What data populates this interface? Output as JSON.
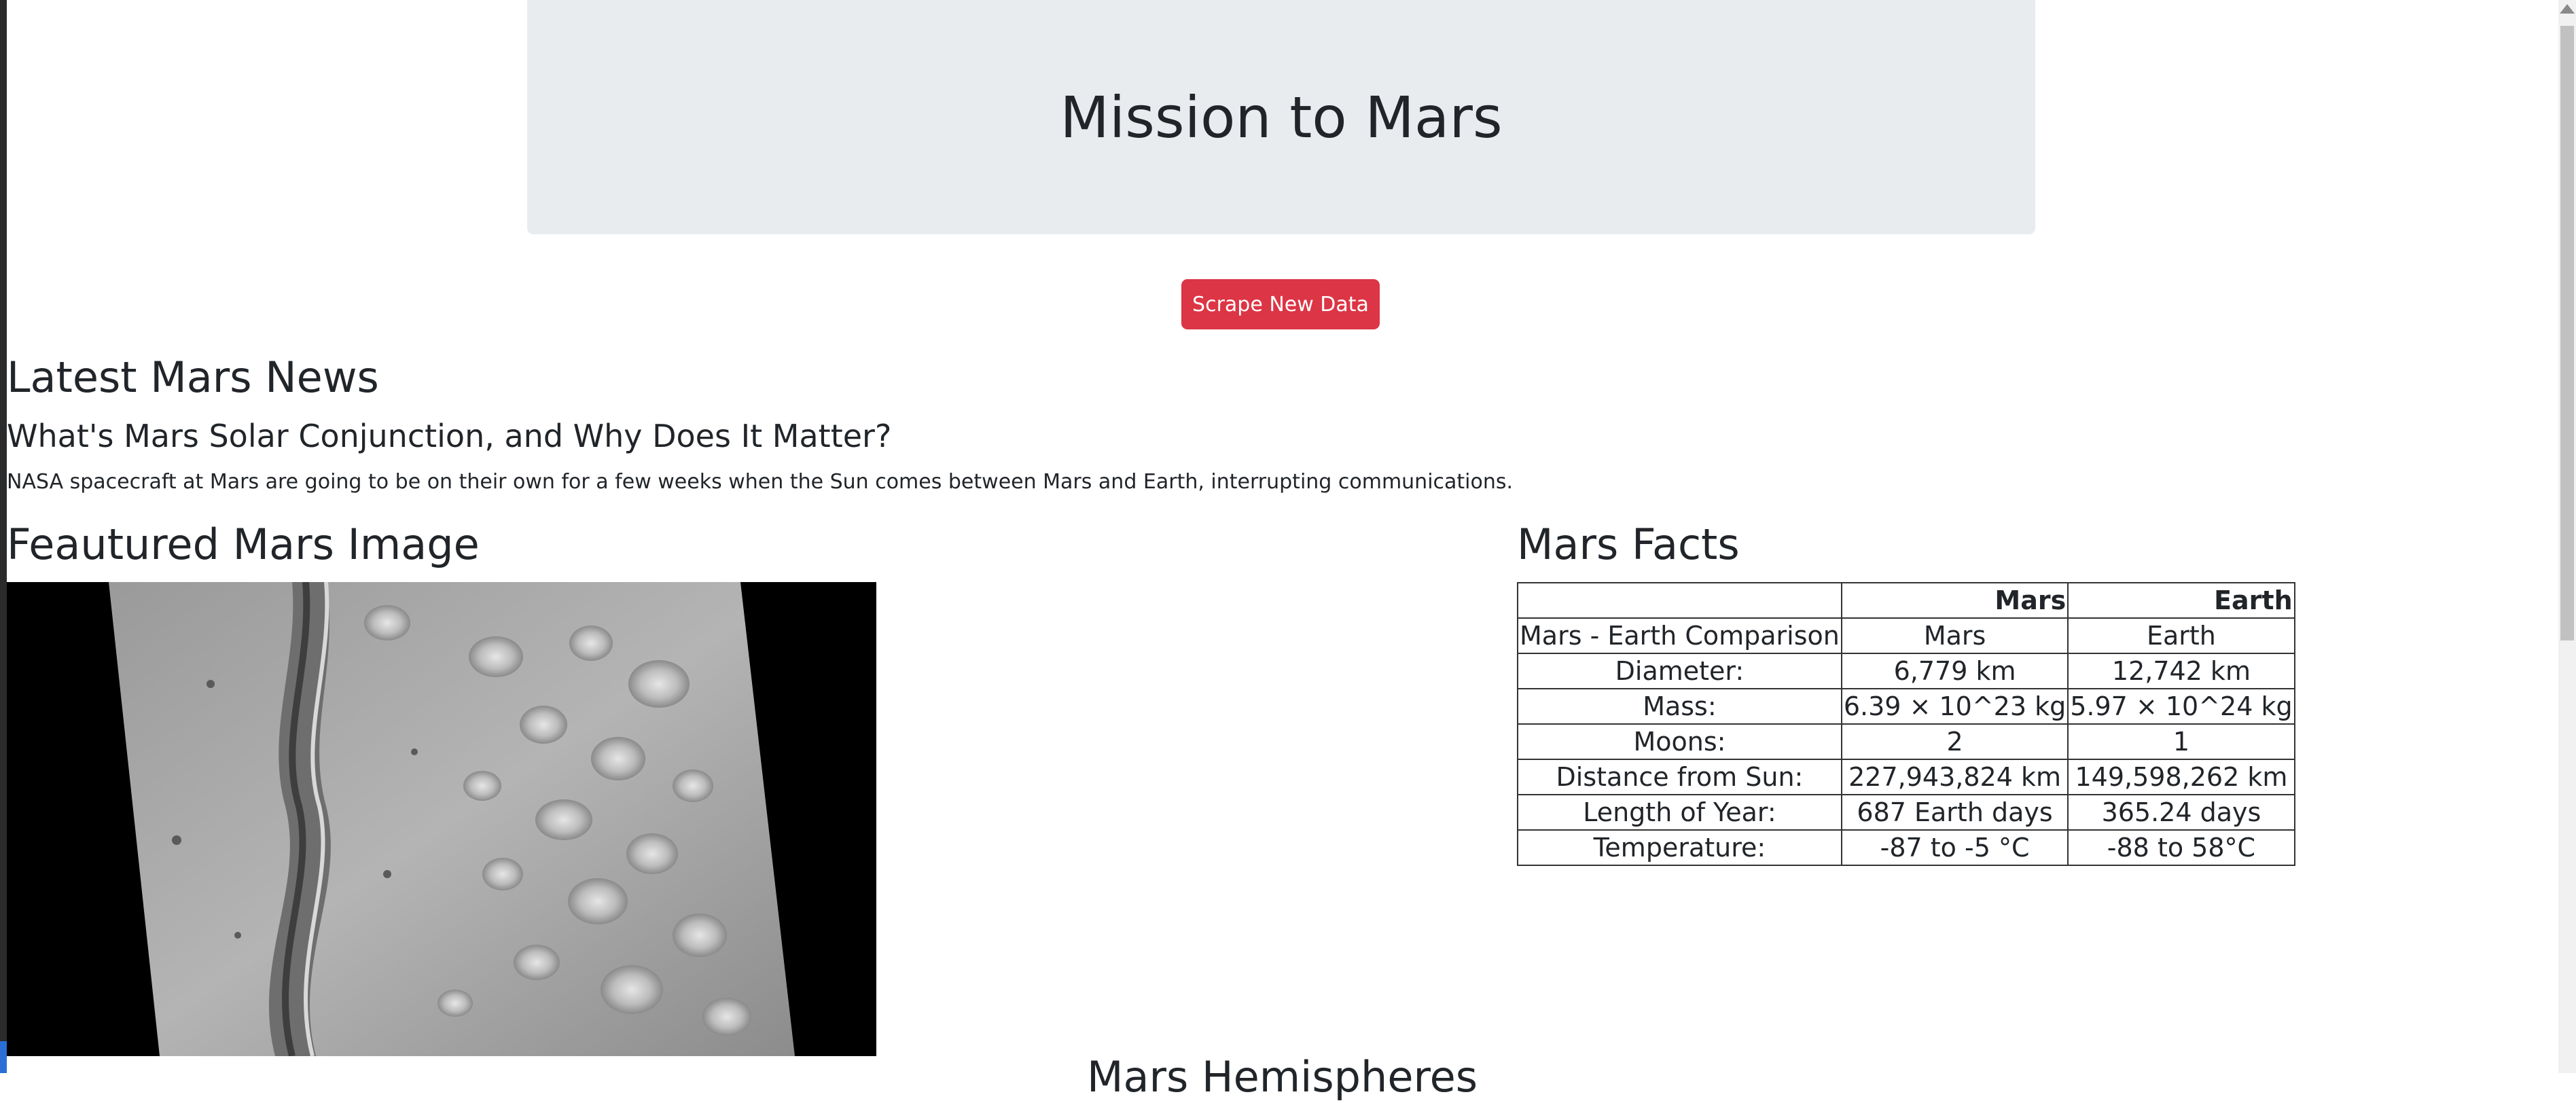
{
  "header": {
    "title": "Mission to Mars"
  },
  "actions": {
    "scrape_label": "Scrape New Data"
  },
  "news": {
    "heading": "Latest Mars News",
    "title": "What's Mars Solar Conjunction, and Why Does It Matter?",
    "paragraph": "NASA spacecraft at Mars are going to be on their own for a few weeks when the Sun comes between Mars and Earth, interrupting communications."
  },
  "featured": {
    "heading": "Feautured Mars Image"
  },
  "facts": {
    "heading": "Mars Facts",
    "columns": [
      "",
      "Mars",
      "Earth"
    ],
    "rows": [
      [
        "Mars - Earth Comparison",
        "Mars",
        "Earth"
      ],
      [
        "Diameter:",
        "6,779 km",
        "12,742 km"
      ],
      [
        "Mass:",
        "6.39 × 10^23 kg",
        "5.97 × 10^24 kg"
      ],
      [
        "Moons:",
        "2",
        "1"
      ],
      [
        "Distance from Sun:",
        "227,943,824 km",
        "149,598,262 km"
      ],
      [
        "Length of Year:",
        "687 Earth days",
        "365.24 days"
      ],
      [
        "Temperature:",
        "-87 to -5 °C",
        "-88 to 58°C"
      ]
    ]
  },
  "hemispheres": {
    "heading": "Mars Hemispheres"
  },
  "colors": {
    "button": "#dc3545",
    "jumbotron": "#e9ecef",
    "text": "#212529"
  }
}
